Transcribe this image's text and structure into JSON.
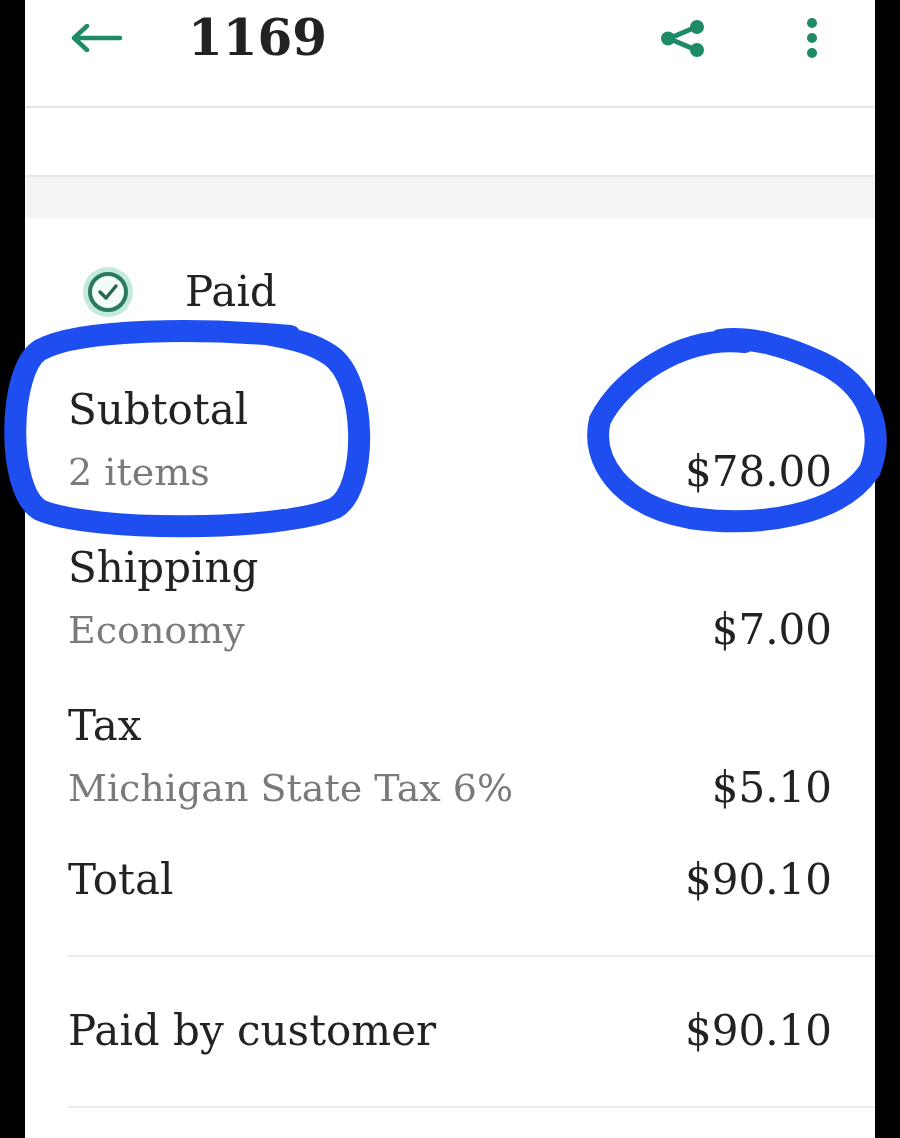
{
  "app_bar": {
    "title": "1169"
  },
  "payment_status": {
    "label": "Paid",
    "paid": true
  },
  "summary": [
    {
      "label": "Subtotal",
      "detail": "2 items",
      "amount": "$78.00",
      "label_circled": true,
      "amount_circled": true
    },
    {
      "label": "Shipping",
      "detail": "Economy",
      "amount": "$7.00",
      "label_circled": false,
      "amount_circled": false
    },
    {
      "label": "Tax",
      "detail": "Michigan State Tax 6%",
      "amount": "$5.10",
      "label_circled": false,
      "amount_circled": false
    },
    {
      "label": "Total",
      "amount": "$90.10",
      "label_circled": false,
      "amount_circled": false
    }
  ],
  "paid_by_customer": {
    "label": "Paid by customer",
    "amount": "$90.10"
  }
}
